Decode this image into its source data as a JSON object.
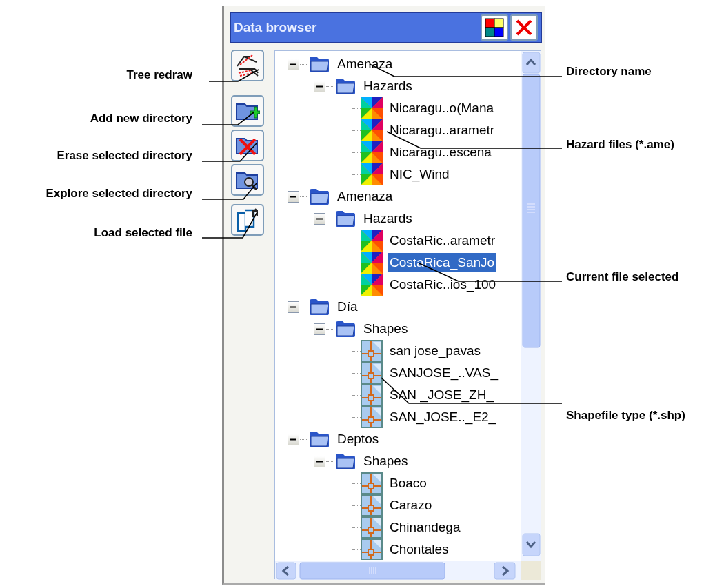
{
  "window": {
    "title": "Data browser"
  },
  "callouts_left": [
    "Tree redraw",
    "Add new directory",
    "Erase selected directory",
    "Explore selected directory",
    "Load selected file"
  ],
  "callouts_right": [
    "Directory name",
    "Hazard files (*.ame)",
    "Current file selected",
    "Shapefile type (*.shp)"
  ],
  "tree": [
    {
      "label": "Amenaza",
      "kind": "folder",
      "expanded": true,
      "selected": false,
      "children": [
        {
          "label": "Hazards",
          "kind": "folder",
          "expanded": true,
          "selected": false,
          "children": [
            {
              "label": "Nicaragu..o(Mana",
              "kind": "hazard",
              "selected": false
            },
            {
              "label": "Nicaragu..arametr",
              "kind": "hazard",
              "selected": false
            },
            {
              "label": "Nicaragu..escena",
              "kind": "hazard",
              "selected": false
            },
            {
              "label": "NIC_Wind",
              "kind": "hazard",
              "selected": false
            }
          ]
        }
      ]
    },
    {
      "label": "Amenaza",
      "kind": "folder",
      "expanded": true,
      "selected": false,
      "children": [
        {
          "label": "Hazards",
          "kind": "folder",
          "expanded": true,
          "selected": false,
          "children": [
            {
              "label": "CostaRic..arametr",
              "kind": "hazard",
              "selected": false
            },
            {
              "label": "CostaRica_SanJo",
              "kind": "hazard",
              "selected": true
            },
            {
              "label": "CostaRic..ios_100",
              "kind": "hazard",
              "selected": false
            }
          ]
        }
      ]
    },
    {
      "label": "Día",
      "kind": "folder",
      "expanded": true,
      "selected": false,
      "children": [
        {
          "label": "Shapes",
          "kind": "folder",
          "expanded": true,
          "selected": false,
          "children": [
            {
              "label": "san jose_pavas",
              "kind": "shape",
              "selected": false
            },
            {
              "label": "SANJOSE_..VAS_",
              "kind": "shape",
              "selected": false
            },
            {
              "label": "SAN _JOSE_ZH_",
              "kind": "shape",
              "selected": false
            },
            {
              "label": "SAN_JOSE.._E2_",
              "kind": "shape",
              "selected": false
            }
          ]
        }
      ]
    },
    {
      "label": "Deptos",
      "kind": "folder",
      "expanded": true,
      "selected": false,
      "children": [
        {
          "label": "Shapes",
          "kind": "folder",
          "expanded": true,
          "selected": false,
          "children": [
            {
              "label": "Boaco",
              "kind": "shape",
              "selected": false
            },
            {
              "label": "Carazo",
              "kind": "shape",
              "selected": false
            },
            {
              "label": "Chinandega",
              "kind": "shape",
              "selected": false
            },
            {
              "label": "Chontales",
              "kind": "shape",
              "selected": false
            }
          ]
        }
      ]
    }
  ]
}
